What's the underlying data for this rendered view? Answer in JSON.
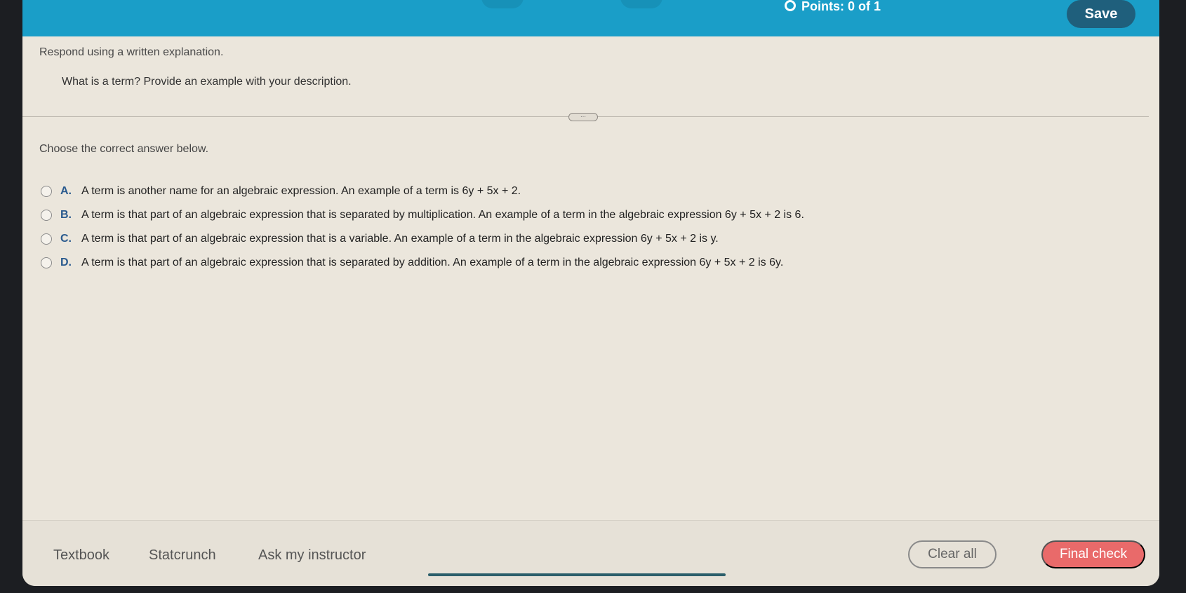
{
  "header": {
    "points_label": "Points: 0 of 1",
    "save_label": "Save",
    "colors": {
      "bar": "#1a9ec8",
      "save_button": "#1f5f7c"
    }
  },
  "question": {
    "instruction": "Respond using a written explanation.",
    "text": "What is a term? Provide an example with your description.",
    "prompt": "Choose the correct answer below.",
    "divider_handle": "⋯",
    "options": [
      {
        "letter": "A.",
        "text": "A term is another name for an algebraic expression. An example of a term is 6y + 5x + 2."
      },
      {
        "letter": "B.",
        "text": "A term is that part of an algebraic expression that is separated by multiplication. An example of a term in the algebraic expression 6y + 5x + 2 is 6."
      },
      {
        "letter": "C.",
        "text": "A term is that part of an algebraic expression that is a variable. An example of a term in the algebraic expression 6y + 5x + 2 is y."
      },
      {
        "letter": "D.",
        "text": "A term is that part of an algebraic expression that is separated by addition. An example of a term in the algebraic expression 6y + 5x + 2 is 6y."
      }
    ]
  },
  "footer": {
    "links": [
      "Textbook",
      "Statcrunch",
      "Ask my instructor"
    ],
    "clear_label": "Clear all",
    "final_label": "Final check",
    "colors": {
      "final_button": "#e96a6a"
    }
  }
}
